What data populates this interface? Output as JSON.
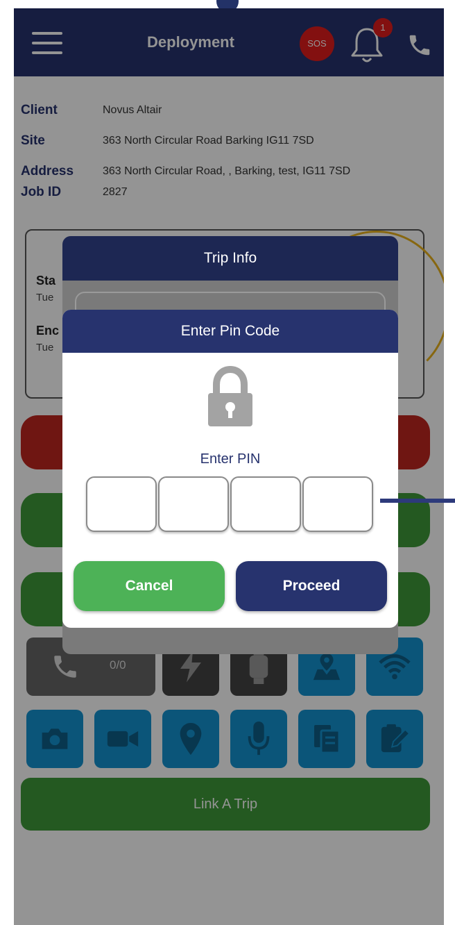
{
  "header": {
    "title": "Deployment",
    "sos_label": "SOS",
    "notification_count": "1",
    "icons": [
      "menu-icon",
      "bell-icon",
      "phone-icon"
    ]
  },
  "job_info": {
    "client_label": "Client",
    "client_value": "Novus Altair",
    "site_label": "Site",
    "site_value": "363 North Circular Road Barking IG11 7SD",
    "address_label": "Address",
    "address_value": "363 North Circular Road, , Barking, test, IG11 7SD",
    "jobid_label": "Job ID",
    "jobid_value": "2827"
  },
  "background_card": {
    "start_label_partial": "Sta",
    "start_day_partial": "Tue",
    "end_label_partial": "Enc",
    "end_day_partial": "Tue"
  },
  "tiles": {
    "call_count": "0/0",
    "row1_icons": [
      "phone-icon",
      "flash-icon",
      "watch-icon",
      "map-icon",
      "wifi-icon"
    ],
    "row2_icons": [
      "camera-icon",
      "video-icon",
      "location-pin-icon",
      "microphone-icon",
      "copy-icon",
      "clipboard-edit-icon"
    ]
  },
  "link_trip_label": "Link A Trip",
  "trip_dialog": {
    "title": "Trip Info"
  },
  "pin_dialog": {
    "title": "Enter Pin Code",
    "prompt": "Enter PIN",
    "digits": [
      "",
      "",
      "",
      ""
    ],
    "cancel_label": "Cancel",
    "proceed_label": "Proceed"
  },
  "colors": {
    "primary_navy": "#27336e",
    "header_dark": "#1d2753",
    "sos_red": "#e21d1d",
    "cancel_green": "#4db257",
    "tile_blue": "#1493d0",
    "pill_green": "#3e9a39",
    "pill_red": "#c0261f"
  }
}
